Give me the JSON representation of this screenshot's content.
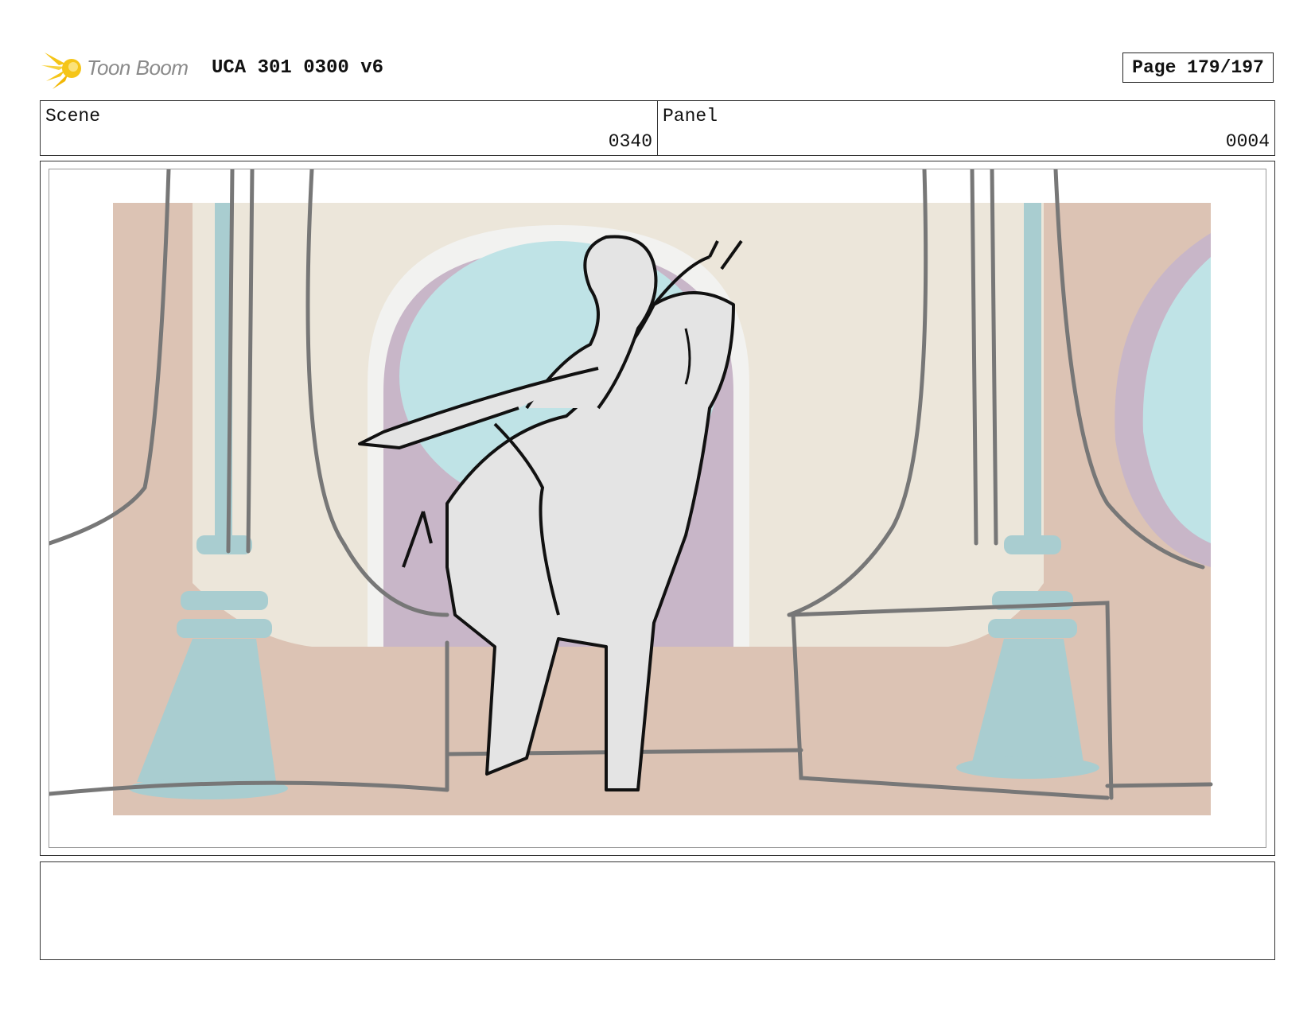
{
  "header": {
    "logo_text": "Toon Boom",
    "title": "UCA 301 0300 v6",
    "page_label": "Page 179/197"
  },
  "info": {
    "scene_label": "Scene",
    "scene_value": "0340",
    "panel_label": "Panel",
    "panel_value": "0004"
  },
  "colors": {
    "logo_yellow": "#f5c518",
    "wall_tan": "#dcc3b4",
    "wall_cream": "#ece6da",
    "window_blue": "#bfe3e6",
    "arch_purple": "#c8b6c8",
    "pillar_teal": "#a9cdd0",
    "horse_grey": "#e4e4e4"
  },
  "notes": {
    "text": ""
  }
}
